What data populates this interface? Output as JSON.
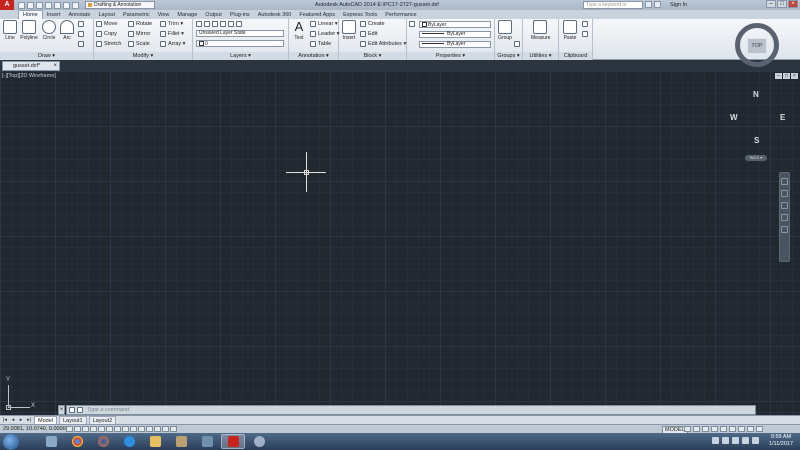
{
  "window": {
    "title": "Autodesk AutoCAD 2014   E:\\PC17-2727-gusset.dxf",
    "workspace": "Drafting & Annotation",
    "search_placeholder": "Type a keyword or phrase",
    "signin": "Sign In"
  },
  "ribbon": {
    "tabs": [
      {
        "label": "Home",
        "active": true
      },
      {
        "label": "Insert"
      },
      {
        "label": "Annotate"
      },
      {
        "label": "Layout"
      },
      {
        "label": "Parametric"
      },
      {
        "label": "View"
      },
      {
        "label": "Manage"
      },
      {
        "label": "Output"
      },
      {
        "label": "Plug-ins"
      },
      {
        "label": "Autodesk 360"
      },
      {
        "label": "Featured Apps"
      },
      {
        "label": "Express Tools"
      },
      {
        "label": "Performance"
      }
    ],
    "draw": {
      "title": "Draw ▾",
      "line": "Line",
      "polyline": "Polyline",
      "circle": "Circle",
      "arc": "Arc"
    },
    "modify": {
      "title": "Modify ▾",
      "move": "Move",
      "rotate": "Rotate",
      "trim": "Trim ▾",
      "copy": "Copy",
      "mirror": "Mirror",
      "fillet": "Fillet ▾",
      "stretch": "Stretch",
      "scale": "Scale",
      "array": "Array ▾"
    },
    "layers": {
      "title": "Layers ▾",
      "layer_state": "Unsaved Layer State",
      "current_layer": "0"
    },
    "annotation": {
      "title": "Annotation ▾",
      "text": "Text",
      "linear": "Linear ▾",
      "leader": "Leader ▾",
      "table": "Table"
    },
    "block": {
      "title": "Block ▾",
      "insert": "Insert",
      "create": "Create",
      "edit": "Edit",
      "edit_attributes": "Edit Attributes ▾"
    },
    "properties": {
      "title": "Properties ▾",
      "color": "ByLayer",
      "linetype": "ByLayer",
      "lineweight": "ByLayer"
    },
    "groups": {
      "title": "Groups ▾",
      "group": "Group"
    },
    "utilities": {
      "title": "Utilities ▾",
      "measure": "Measure"
    },
    "clipboard": {
      "title": "Clipboard",
      "paste": "Paste"
    }
  },
  "file_tab": {
    "label": "gusset.dxf*"
  },
  "viewport": {
    "label": "[-][Top][2D Wireframe]",
    "viewcube": {
      "top": "TOP",
      "n": "N",
      "s": "S",
      "e": "E",
      "w": "W",
      "wcs": "WCS ▾"
    }
  },
  "ucs": {
    "x": "X",
    "y": "Y"
  },
  "command": {
    "placeholder": "Type a command"
  },
  "layout_tabs": [
    {
      "label": "Model",
      "active": true
    },
    {
      "label": "Layout1"
    },
    {
      "label": "Layout2"
    }
  ],
  "status": {
    "coords": "29.0081, 10.0740, 0.0000",
    "model": "MODEL"
  },
  "taskbar": {
    "time": "9:59 AM",
    "date": "1/11/2017"
  },
  "colors": {
    "canvas": "#212830",
    "autocad_red": "#c8231c"
  }
}
